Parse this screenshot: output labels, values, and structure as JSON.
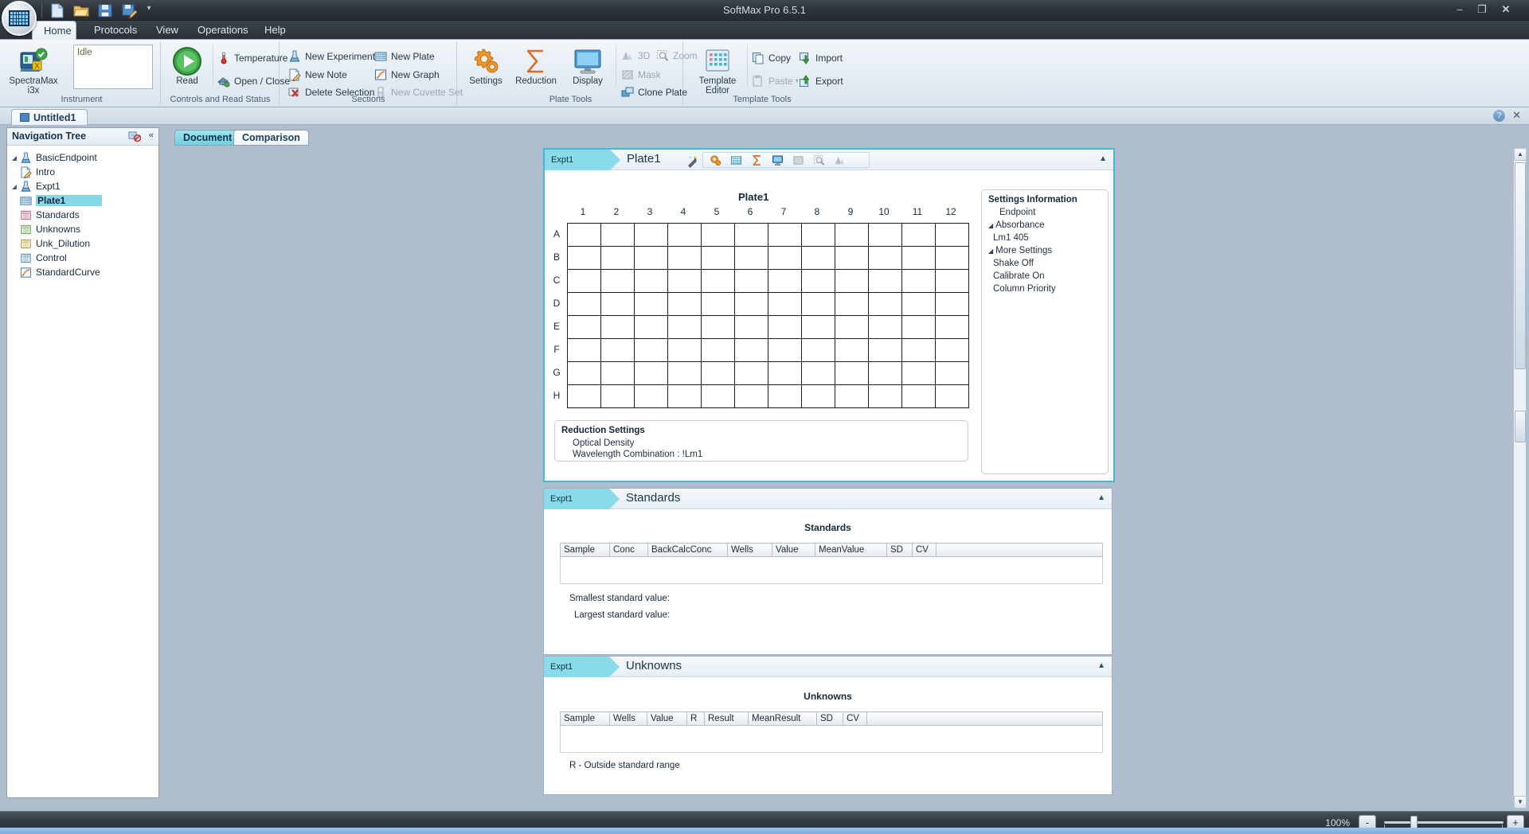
{
  "window": {
    "title": "SoftMax Pro 6.5.1",
    "minimize": "–",
    "maximize": "❐",
    "close": "✕"
  },
  "quick_access": {
    "items": [
      {
        "name": "new-document-icon",
        "tip": "New"
      },
      {
        "name": "open-folder-icon",
        "tip": "Open"
      },
      {
        "name": "save-disk-icon",
        "tip": "Save"
      },
      {
        "name": "save-as-icon",
        "tip": "Save As"
      }
    ],
    "dropdown": "▾"
  },
  "ribbon": {
    "tabs": [
      {
        "label": "Home",
        "active": true
      },
      {
        "label": "Protocols",
        "active": false
      },
      {
        "label": "View",
        "active": false
      },
      {
        "label": "Operations",
        "active": false
      },
      {
        "label": "Help",
        "active": false
      }
    ],
    "groups": [
      {
        "name": "instrument",
        "label": "Instrument",
        "big": {
          "label_line1": "SpectraMax",
          "label_line2": "i3x",
          "icon": "instrument-icon"
        },
        "status_text": "Idle"
      },
      {
        "name": "controls",
        "label": "Controls and Read Status",
        "big": {
          "label_line1": "Read",
          "label_line2": "",
          "icon": "read-play-icon"
        },
        "items": [
          {
            "label": "Temperature",
            "icon": "thermometer-icon",
            "disabled": false
          },
          {
            "label": "Open / Close",
            "icon": "drawer-icon",
            "disabled": false
          }
        ]
      },
      {
        "name": "sections",
        "label": "Sections",
        "items": [
          {
            "label": "New Experiment",
            "icon": "flask-icon",
            "disabled": false
          },
          {
            "label": "New Plate",
            "icon": "plate-icon",
            "disabled": false
          },
          {
            "label": "New Note",
            "icon": "note-icon",
            "disabled": false
          },
          {
            "label": "New Graph",
            "icon": "graph-icon",
            "disabled": false
          },
          {
            "label": "Delete Selection",
            "icon": "delete-icon",
            "disabled": false
          },
          {
            "label": "New Cuvette Set",
            "icon": "cuvette-icon",
            "disabled": true
          }
        ]
      },
      {
        "name": "plate-tools",
        "label": "Plate Tools",
        "bigs": [
          {
            "label": "Settings",
            "icon": "settings-gear-icon"
          },
          {
            "label": "Reduction",
            "icon": "sigma-icon"
          },
          {
            "label": "Display",
            "icon": "monitor-icon"
          }
        ],
        "items": [
          {
            "label": "3D",
            "icon": "3d-icon",
            "disabled": true
          },
          {
            "label": "Zoom",
            "icon": "zoom-icon",
            "disabled": true
          },
          {
            "label": "Mask",
            "icon": "mask-icon",
            "disabled": true
          },
          {
            "label": "Clone Plate",
            "icon": "clone-plate-icon",
            "disabled": false
          }
        ]
      },
      {
        "name": "template-tools",
        "label": "Template Tools",
        "big": {
          "label_line1": "Template",
          "label_line2": "Editor",
          "icon": "template-editor-icon"
        },
        "items": [
          {
            "label": "Copy",
            "icon": "copy-icon",
            "disabled": false
          },
          {
            "label": "Import",
            "icon": "import-icon",
            "disabled": false
          },
          {
            "label": "Paste",
            "icon": "paste-icon",
            "disabled": true
          },
          {
            "label": "Export",
            "icon": "export-icon",
            "disabled": false
          }
        ]
      }
    ]
  },
  "document_tab": {
    "label": "Untitled1",
    "help": "?",
    "close": "✕"
  },
  "navigation": {
    "title": "Navigation Tree",
    "pin_icon": "unpin-icon",
    "collapse_icon": "collapse-left-icon",
    "items": [
      {
        "label": "BasicEndpoint",
        "icon": "flask-icon",
        "indent": 0,
        "arrow": "◢",
        "selected": false
      },
      {
        "label": "Intro",
        "icon": "note-icon",
        "indent": 1,
        "arrow": "",
        "selected": false
      },
      {
        "label": "Expt1",
        "icon": "flask-icon",
        "indent": 0,
        "arrow": "◢",
        "selected": false
      },
      {
        "label": "Plate1",
        "icon": "plate-blue-icon",
        "indent": 1,
        "arrow": "",
        "selected": true
      },
      {
        "label": "Standards",
        "icon": "grid-pink-icon",
        "indent": 1,
        "arrow": "",
        "selected": false
      },
      {
        "label": "Unknowns",
        "icon": "grid-green-icon",
        "indent": 1,
        "arrow": "",
        "selected": false
      },
      {
        "label": "Unk_Dilution",
        "icon": "grid-yellow-icon",
        "indent": 1,
        "arrow": "",
        "selected": false
      },
      {
        "label": "Control",
        "icon": "grid-blue-icon",
        "indent": 1,
        "arrow": "",
        "selected": false
      },
      {
        "label": "StandardCurve",
        "icon": "graph-icon",
        "indent": 1,
        "arrow": "",
        "selected": false
      }
    ]
  },
  "view_tabs": [
    {
      "label": "Document",
      "active": true
    },
    {
      "label": "Comparison",
      "active": false
    }
  ],
  "sections": {
    "plate": {
      "expt": "Expt1",
      "title": "Plate1",
      "collapse": "▲",
      "toolbar": [
        {
          "name": "magic-wand-icon",
          "disabled": false
        },
        {
          "name": "settings-gear-icon",
          "disabled": false
        },
        {
          "name": "template-icon",
          "disabled": false
        },
        {
          "name": "sigma-icon",
          "disabled": false
        },
        {
          "name": "monitor-icon",
          "disabled": false
        },
        {
          "name": "mask-icon",
          "disabled": true
        },
        {
          "name": "zoom-icon",
          "disabled": true
        },
        {
          "name": "3d-icon",
          "disabled": true
        }
      ],
      "plate_label": "Plate1",
      "columns": [
        "1",
        "2",
        "3",
        "4",
        "5",
        "6",
        "7",
        "8",
        "9",
        "10",
        "11",
        "12"
      ],
      "rows": [
        "A",
        "B",
        "C",
        "D",
        "E",
        "F",
        "G",
        "H"
      ],
      "settings_info": {
        "title": "Settings Information",
        "lines": [
          {
            "text": "Endpoint",
            "indent": 1,
            "tri": false
          },
          {
            "text": "Absorbance",
            "indent": 0,
            "tri": true
          },
          {
            "text": "Lm1    405",
            "indent": 0,
            "tri": false
          },
          {
            "text": "More Settings",
            "indent": 0,
            "tri": true
          },
          {
            "text": "Shake  Off",
            "indent": 0,
            "tri": false
          },
          {
            "text": "Calibrate  On",
            "indent": 0,
            "tri": false
          },
          {
            "text": "Column Priority",
            "indent": 0,
            "tri": false
          }
        ]
      },
      "reduction_settings": {
        "title": "Reduction Settings",
        "lines": [
          "Optical Density",
          "Wavelength Combination : !Lm1"
        ]
      }
    },
    "standards": {
      "expt": "Expt1",
      "title": "Standards",
      "collapse": "▲",
      "table_title": "Standards",
      "columns": [
        "Sample",
        "Conc",
        "BackCalcConc",
        "Wells",
        "Value",
        "MeanValue",
        "SD",
        "CV"
      ],
      "rows": [],
      "notes": [
        "Smallest standard value:",
        "Largest standard value:"
      ]
    },
    "unknowns": {
      "expt": "Expt1",
      "title": "Unknowns",
      "collapse": "▲",
      "table_title": "Unknowns",
      "columns": [
        "Sample",
        "Wells",
        "Value",
        "R",
        "Result",
        "MeanResult",
        "SD",
        "CV"
      ],
      "rows": [],
      "notes": [
        "R - Outside standard range"
      ]
    }
  },
  "status_bar": {
    "zoom_percent": "100%",
    "zoom_out": "-",
    "zoom_in": "+"
  },
  "colors": {
    "accent_cyan": "#86d7e8",
    "focus_border": "#44b7d8",
    "title_bar": "#2e343c",
    "canvas": "#aebecd"
  }
}
